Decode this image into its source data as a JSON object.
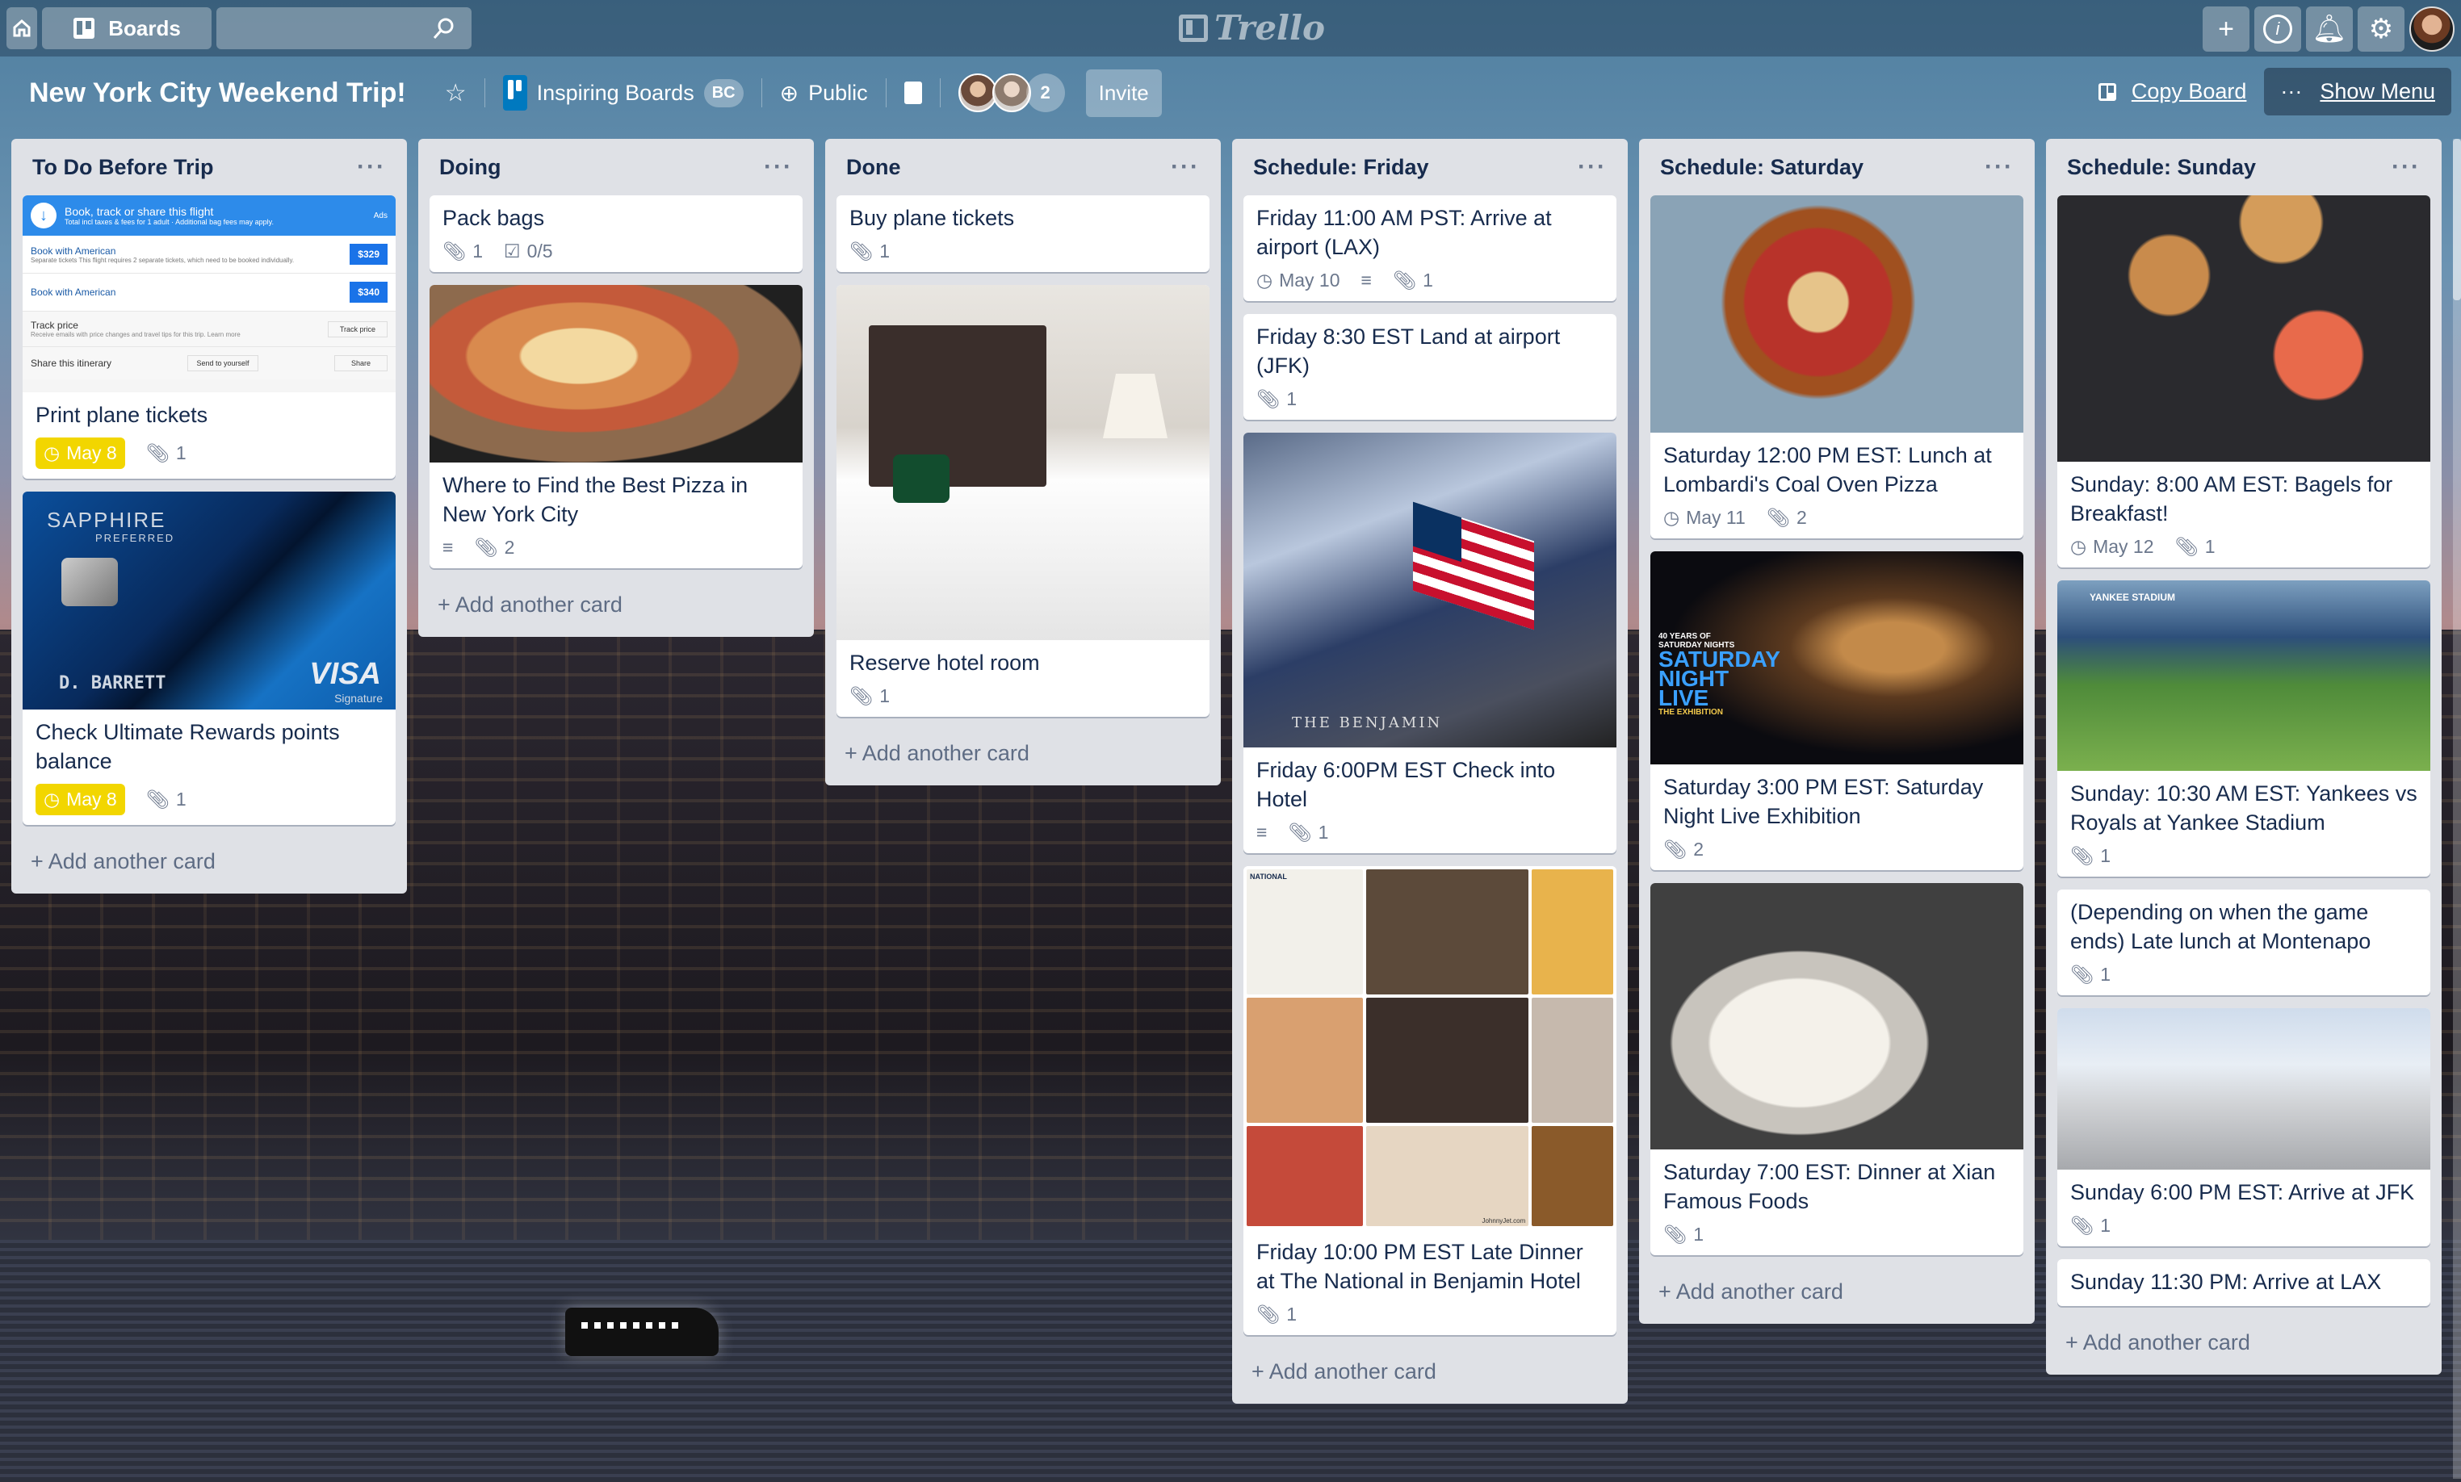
{
  "topbar": {
    "boards_label": "Boards",
    "search_placeholder": "",
    "logo_text": "Trello"
  },
  "board": {
    "title": "New York City Weekend Trip!",
    "team_name": "Inspiring Boards",
    "team_badge": "BC",
    "visibility": "Public",
    "member_overflow": "2",
    "invite_label": "Invite",
    "copy_board_label": "Copy Board",
    "show_menu_label": "Show Menu"
  },
  "add_card_label": "+ Add another card",
  "lists": [
    {
      "title": "To Do Before Trip",
      "cards": [
        {
          "title": "Print plane tickets",
          "due": "May 8",
          "attachments": "1",
          "cover": {
            "header": "Book, track or share this flight",
            "subheader": "Total incl taxes & fees for 1 adult · Additional bag fees may apply.",
            "ads": "Ads",
            "row1_label": "Book with American",
            "row1_note": "Separate tickets  This flight requires 2 separate tickets, which need to be booked individually.",
            "row1_price": "$329",
            "row2_label": "Book with American",
            "row2_price": "$340",
            "track_title": "Track price",
            "track_desc": "Receive emails with price changes and travel tips for this trip. Learn more",
            "track_button": "Track price",
            "share_title": "Share this itinerary",
            "send_button": "Send to yourself",
            "share_button": "Share"
          }
        },
        {
          "title": "Check Ultimate Rewards points balance",
          "due": "May 8",
          "attachments": "1",
          "cover": {
            "brand": "SAPPHIRE",
            "tier": "PREFERRED",
            "holder": "D. BARRETT",
            "network": "VISA",
            "network_sub": "Signature"
          }
        }
      ]
    },
    {
      "title": "Doing",
      "cards": [
        {
          "title": "Pack bags",
          "attachments": "1",
          "checklist": "0/5"
        },
        {
          "title": "Where to Find the Best Pizza in New York City",
          "attachments": "2",
          "description": true
        }
      ]
    },
    {
      "title": "Done",
      "cards": [
        {
          "title": "Buy plane tickets",
          "attachments": "1"
        },
        {
          "title": "Reserve hotel room",
          "attachments": "1"
        }
      ]
    },
    {
      "title": "Schedule: Friday",
      "cards": [
        {
          "title": "Friday 11:00 AM PST: Arrive at airport (LAX)",
          "due": "May 10",
          "description": true,
          "attachments": "1"
        },
        {
          "title": "Friday 8:30 EST Land at airport (JFK)",
          "attachments": "1"
        },
        {
          "title": "Friday 6:00PM EST Check into Hotel",
          "description": true,
          "attachments": "1",
          "cover": {
            "sign": "THE BENJAMIN"
          }
        },
        {
          "title": "Friday 10:00 PM EST Late Dinner at The National in Benjamin Hotel",
          "attachments": "1",
          "cover": {
            "watermark": "JohnnyJet.com",
            "menu": "NATIONAL"
          }
        }
      ]
    },
    {
      "title": "Schedule: Saturday",
      "cards": [
        {
          "title": "Saturday 12:00 PM EST: Lunch at Lombardi's Coal Oven Pizza",
          "due": "May 11",
          "attachments": "2"
        },
        {
          "title": "Saturday 3:00 PM EST: Saturday Night Live Exhibition",
          "attachments": "2",
          "cover": {
            "caption": "40 YEARS OF SATURDAY NIGHTS",
            "logo": "SATURDAY NIGHT LIVE",
            "sub": "THE EXHIBITION"
          }
        },
        {
          "title": "Saturday 7:00 EST: Dinner at Xian Famous Foods",
          "attachments": "1"
        }
      ]
    },
    {
      "title": "Schedule: Sunday",
      "cards": [
        {
          "title": "Sunday: 8:00 AM EST: Bagels for Breakfast!",
          "due": "May 12",
          "attachments": "1"
        },
        {
          "title": "Sunday: 10:30 AM EST: Yankees vs Royals at Yankee Stadium",
          "attachments": "1",
          "cover": {
            "sign": "YANKEE STADIUM"
          }
        },
        {
          "title": "(Depending on when the game ends) Late lunch at Montenapo",
          "attachments": "1"
        },
        {
          "title": "Sunday 6:00 PM EST: Arrive at JFK",
          "attachments": "1"
        },
        {
          "title": "Sunday 11:30 PM: Arrive at LAX"
        }
      ]
    }
  ],
  "colors": {
    "due_soon": "#f2d600",
    "list_bg": "#dfe1e6",
    "card_text": "#172b4d",
    "meta": "#6b778c"
  }
}
